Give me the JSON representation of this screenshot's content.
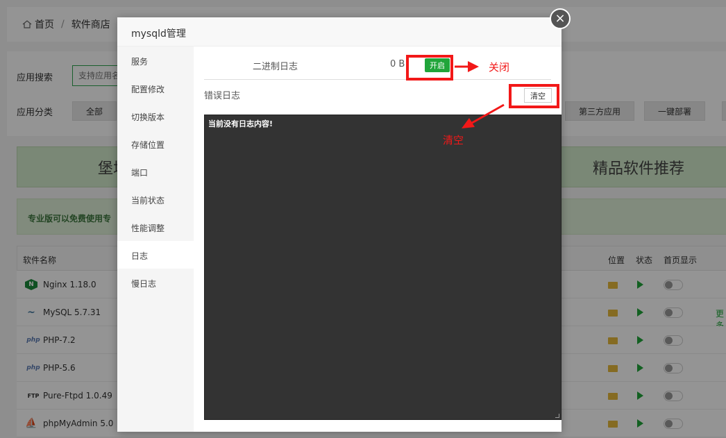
{
  "breadcrumb": {
    "home": "首页",
    "separator": "/",
    "current": "软件商店"
  },
  "search": {
    "label": "应用搜索",
    "placeholder": "支持应用名"
  },
  "categories": {
    "label": "应用分类",
    "items": [
      "全部",
      "第三方应用",
      "一键部署"
    ]
  },
  "banners": {
    "left": "堡塔运",
    "right": "精品软件推荐"
  },
  "pro_notice": "专业版可以免费使用专",
  "table": {
    "headers": {
      "name": "软件名称",
      "location": "位置",
      "status": "状态",
      "homepage": "首页显示"
    },
    "rows": [
      {
        "icon": "nginx-icon",
        "name": "Nginx 1.18.0",
        "more": ""
      },
      {
        "icon": "mysql-icon",
        "name": "MySQL 5.7.31",
        "more": "更多"
      },
      {
        "icon": "php-icon",
        "name": "PHP-7.2",
        "more": ""
      },
      {
        "icon": "php-icon",
        "name": "PHP-5.6",
        "more": ""
      },
      {
        "icon": "ftp-icon",
        "name": "Pure-Ftpd 1.0.49",
        "more": ""
      },
      {
        "icon": "phpmyadmin-icon",
        "name": "phpMyAdmin 5.0",
        "more": ""
      }
    ]
  },
  "modal": {
    "title": "mysqld管理",
    "close": "×",
    "sidebar": [
      "服务",
      "配置修改",
      "切换版本",
      "存储位置",
      "端口",
      "当前状态",
      "性能调整",
      "日志",
      "慢日志"
    ],
    "active_index": 7,
    "binlog": {
      "label": "二进制日志",
      "size": "0 B",
      "button": "开启"
    },
    "errlog": {
      "label": "错误日志",
      "clear_button": "清空"
    },
    "log_content": "当前没有日志内容!"
  },
  "annotations": {
    "close_note": "关闭",
    "clear_note": "清空",
    "color": "#f21818"
  },
  "colors": {
    "accent_green": "#20a53a",
    "banner_green": "#d3ebcb",
    "log_bg": "#333333"
  }
}
